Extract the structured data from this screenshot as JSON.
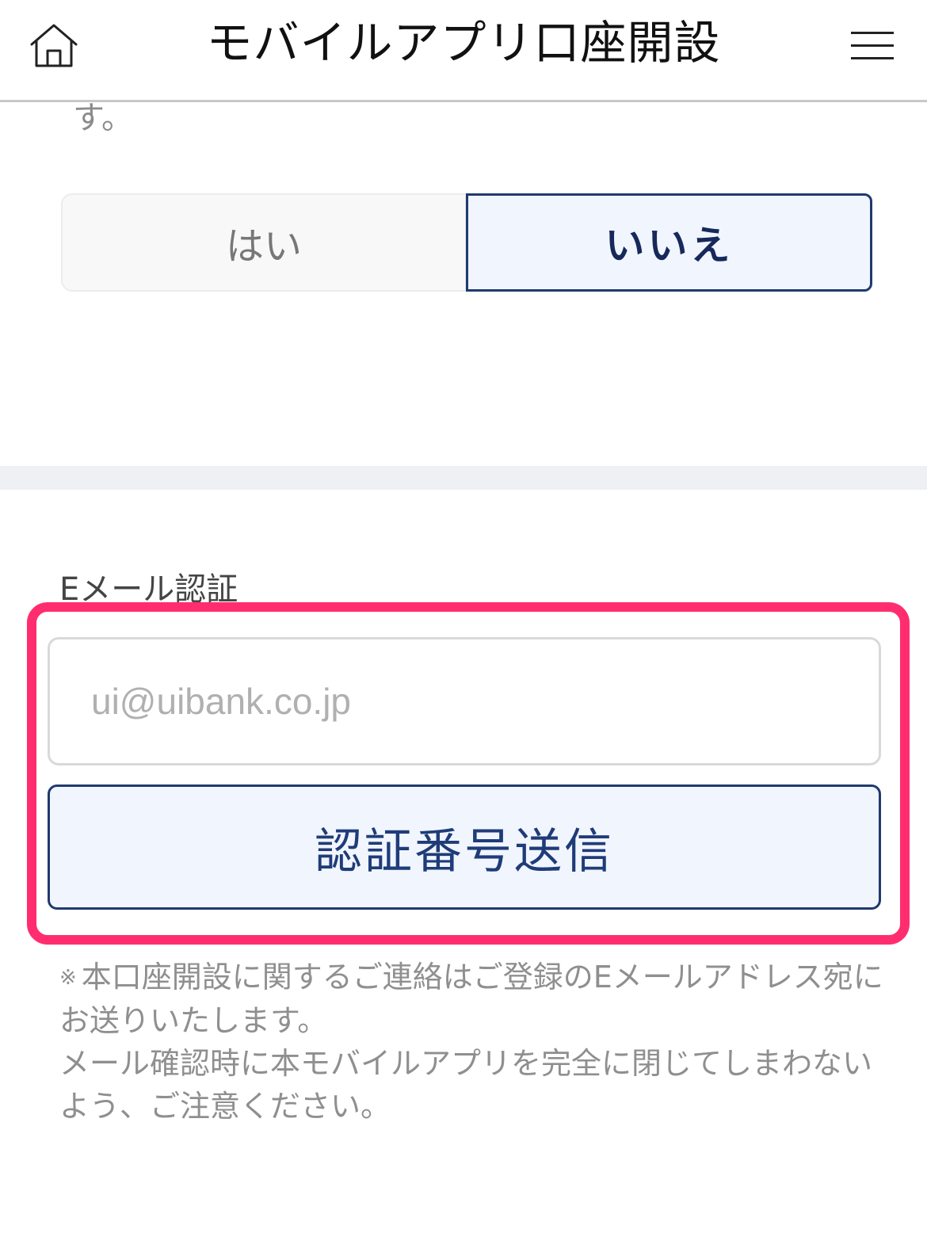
{
  "header": {
    "title": "モバイルアプリ口座開設",
    "home_icon": "home-icon",
    "menu_icon": "hamburger-menu-icon"
  },
  "previous_question": {
    "trailing_text": "す。"
  },
  "answer_toggle": {
    "yes_label": "はい",
    "no_label": "いいえ",
    "selected": "いいえ"
  },
  "email_section": {
    "label": "Eメール認証",
    "email_placeholder": "ui@uibank.co.jp",
    "send_button_label": "認証番号送信"
  },
  "notes": {
    "mark": "※",
    "line1": "本口座開設に関するご連絡はご登録のEメールアドレス宛にお送りいたします。",
    "line2": "メール確認時に本モバイルアプリを完全に閉じてしまわないよう、ご注意ください。"
  },
  "colors": {
    "accent_navy": "#1f3a6e",
    "selected_bg": "#f1f5fd",
    "highlight_pink": "#ff2d6f",
    "divider_gray": "#eef0f4"
  }
}
